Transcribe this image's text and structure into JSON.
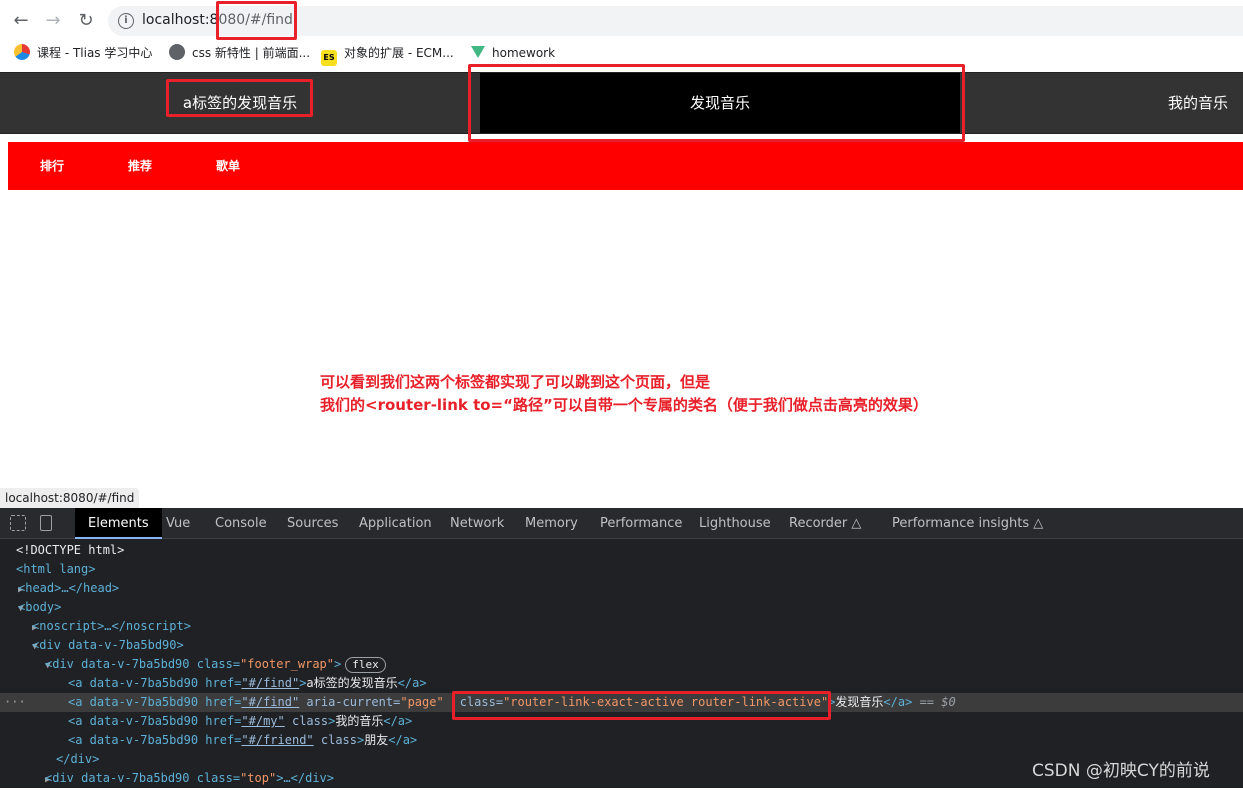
{
  "browser": {
    "url_host": "localhost:8",
    "url_rest": "080/#/find",
    "bookmarks": [
      {
        "label": "课程 - Tlias 学习中心",
        "icon": "tlias-icon"
      },
      {
        "label": "css 新特性 | 前端面...",
        "icon": "globe-icon"
      },
      {
        "label": "对象的扩展 - ECM...",
        "icon": "es-icon",
        "badge": "ES"
      },
      {
        "label": "homework",
        "icon": "vue-icon"
      }
    ]
  },
  "page": {
    "nav": {
      "a_find": "a标签的发现音乐",
      "find": "发现音乐",
      "my": "我的音乐"
    },
    "subnav": [
      "排行",
      "推荐",
      "歌单"
    ],
    "note_line1": "可以看到我们这两个标签都实现了可以跳到这个页面，但是",
    "note_line2": "我们的<router-link to=“路径”可以自带一个专属的类名（便于我们做点击高亮的效果）",
    "status_url": "localhost:8080/#/find"
  },
  "devtools": {
    "tabs": [
      "Elements",
      "Vue",
      "Console",
      "Sources",
      "Application",
      "Network",
      "Memory",
      "Performance",
      "Lighthouse",
      "Recorder",
      "Performance insights"
    ],
    "dom": {
      "doctype": "<!DOCTYPE html>",
      "html_open": "<html lang>",
      "head": "<head>…</head>",
      "body_open": "<body>",
      "noscript": "<noscript>…</noscript>",
      "div_root": "<div data-v-7ba5bd90>",
      "footer_tag_open": "<div data-v-7ba5bd90 class=",
      "footer_class": "\"footer_wrap\"",
      "footer_tag_close": ">",
      "flex_badge": "flex",
      "a_prefix": "<a data-v-7ba5bd90 href=",
      "a1_href": "\"#/find\"",
      "a1_text": "a标签的发现音乐",
      "a2_href": "\"#/find\"",
      "a2_attr": " aria-current=",
      "a2_attr_val": "\"page\"",
      "a2_class_attr": "class=",
      "a2_class_val": "\"router-link-exact-active router-link-active\"",
      "a2_text": "发现音乐",
      "a_close": "</a>",
      "dollar": "== $0",
      "a3_href": "\"#/my\"",
      "a3_class": " class",
      "a3_text": "我的音乐",
      "a4_href": "\"#/friend\"",
      "a4_class": " class",
      "a4_text": "朋友",
      "div_close": "</div>",
      "top_tag_open": "<div data-v-7ba5bd90 class=",
      "top_class": "\"top\"",
      "top_tag_close": ">…</div>",
      "gt": ">"
    }
  },
  "watermark": "CSDN @初映CY的前说",
  "colors": {
    "annotation_red": "#e8202a",
    "nav_bg": "#333333",
    "subnav_bg": "#ff0000",
    "active_bg": "#000000"
  }
}
